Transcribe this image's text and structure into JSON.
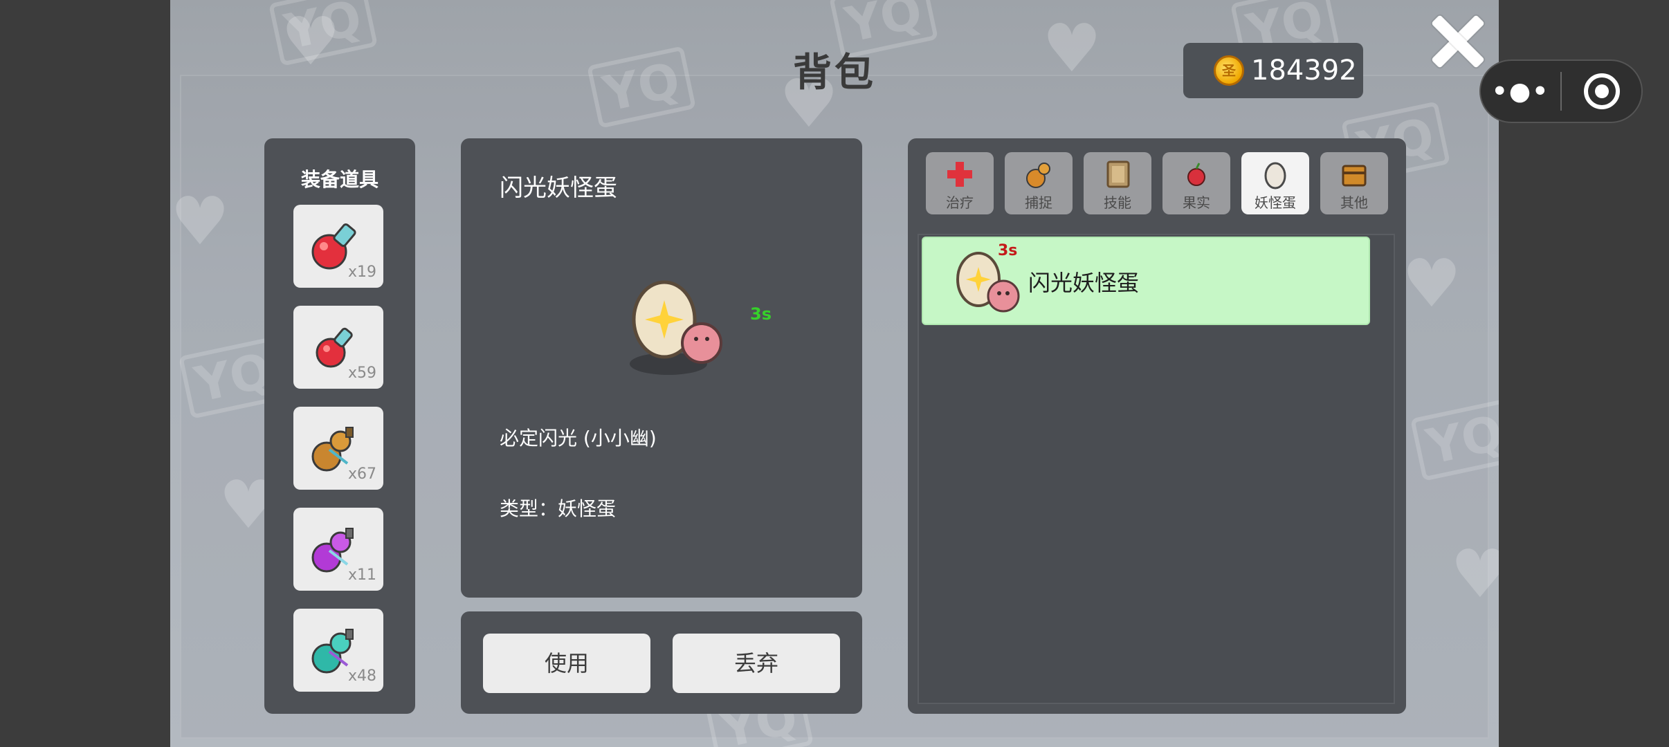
{
  "header": {
    "title": "背包",
    "coins": "184392",
    "coin_symbol": "圣"
  },
  "equip_panel": {
    "heading": "装备道具",
    "slots": [
      {
        "icon": "red-potion-icon",
        "count": "x19"
      },
      {
        "icon": "small-red-potion-icon",
        "count": "x59"
      },
      {
        "icon": "gourd-icon",
        "count": "x67"
      },
      {
        "icon": "purple-potion-icon",
        "count": "x11"
      },
      {
        "icon": "teal-potion-icon",
        "count": "x48"
      }
    ]
  },
  "detail": {
    "name": "闪光妖怪蛋",
    "timer": "3s",
    "description": "必定闪光 (小小幽)",
    "type_line": "类型：妖怪蛋"
  },
  "actions": {
    "use_label": "使用",
    "discard_label": "丢弃"
  },
  "tabs": [
    {
      "label": "治疗",
      "icon": "heal-cross-icon",
      "active": false
    },
    {
      "label": "捕捉",
      "icon": "capture-gourd-icon",
      "active": false
    },
    {
      "label": "技能",
      "icon": "skill-book-icon",
      "active": false
    },
    {
      "label": "果实",
      "icon": "fruit-icon",
      "active": false
    },
    {
      "label": "妖怪蛋",
      "icon": "egg-icon",
      "active": true
    },
    {
      "label": "其他",
      "icon": "chest-icon",
      "active": false
    }
  ],
  "list": [
    {
      "name": "闪光妖怪蛋",
      "timer": "3s",
      "icon": "shiny-egg-icon",
      "selected": true
    }
  ],
  "mini_program": {
    "more_label": "•●•"
  },
  "watermark": "YQ",
  "colors": {
    "selected_row": "#c6f7c6",
    "timer_green": "#36d12a",
    "timer_red": "#c41a1a",
    "panel": "#4e5156"
  }
}
